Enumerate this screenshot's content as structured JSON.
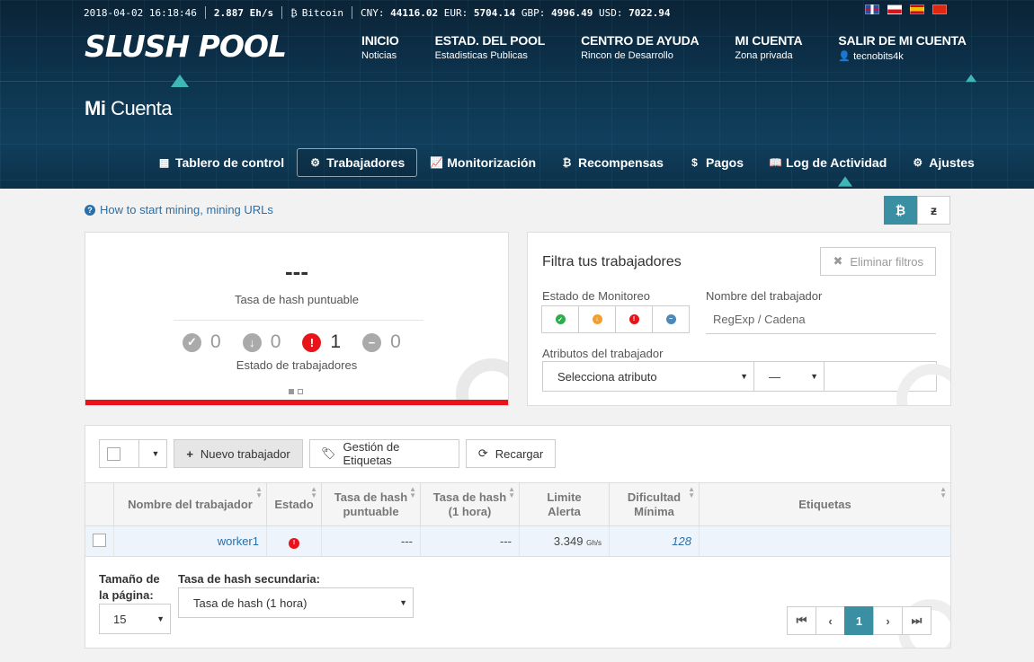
{
  "ticker": {
    "datetime": "2018-04-02 16:18:46",
    "hashrate": "2.887 Eh/s",
    "coin_symbol": "₿",
    "coin": "Bitcoin",
    "cny_label": "CNY:",
    "cny": "44116.02",
    "eur_label": "EUR:",
    "eur": "5704.14",
    "gbp_label": "GBP:",
    "gbp": "4996.49",
    "usd_label": "USD:",
    "usd": "7022.94"
  },
  "flags": [
    {
      "name": "uk-flag",
      "color": "#2b4c9a"
    },
    {
      "name": "czech-flag",
      "color": "#d7141a"
    },
    {
      "name": "spain-flag",
      "color": "#f1bf00"
    },
    {
      "name": "china-flag",
      "color": "#de2910"
    }
  ],
  "logo": "SLUSH POOL",
  "nav": [
    {
      "title": "INICIO",
      "sub": "Noticias"
    },
    {
      "title": "ESTAD. DEL POOL",
      "sub": "Estadisticas Publicas"
    },
    {
      "title": "CENTRO DE AYUDA",
      "sub": "Rincon de Desarrollo"
    },
    {
      "title": "MI CUENTA",
      "sub": "Zona privada"
    },
    {
      "title": "SALIR DE MI CUENTA",
      "sub": "tecnobits4k"
    }
  ],
  "page_title": {
    "bold": "Mi",
    "rest": " Cuenta"
  },
  "tabs": [
    {
      "label": "Tablero de control",
      "icon": "dashboard-icon"
    },
    {
      "label": "Trabajadores",
      "icon": "cogs-icon"
    },
    {
      "label": "Monitorización",
      "icon": "chart-icon"
    },
    {
      "label": "Recompensas",
      "icon": "bitcoin-icon"
    },
    {
      "label": "Pagos",
      "icon": "dollar-icon"
    },
    {
      "label": "Log de Actividad",
      "icon": "book-icon"
    },
    {
      "label": "Ajustes",
      "icon": "gear-icon"
    }
  ],
  "active_tab": "Trabajadores",
  "help_link": "How to start mining, mining URLs",
  "currency": {
    "btc": "₿",
    "zec": "ƶ"
  },
  "stats": {
    "hash_value": "---",
    "hash_label": "Tasa de hash puntuable",
    "counts": [
      {
        "name": "ok",
        "value": "0",
        "color": "#aaa"
      },
      {
        "name": "low",
        "value": "0",
        "color": "#aaa"
      },
      {
        "name": "error",
        "value": "1",
        "color": "#e8141a"
      },
      {
        "name": "off",
        "value": "0",
        "color": "#aaa"
      }
    ],
    "status_label": "Estado de trabajadores"
  },
  "filter": {
    "title": "Filtra tus trabajadores",
    "clear_label": "Eliminar filtros",
    "monitor_label": "Estado de Monitoreo",
    "name_label": "Nombre del trabajador",
    "name_placeholder": "RegExp / Cadena",
    "attr_label": "Atributos del trabajador",
    "attr_select": "Selecciona atributo",
    "op_select": "—"
  },
  "toolbar": {
    "new_worker": "Nuevo trabajador",
    "tags": "Gestión de Etiquetas",
    "reload": "Recargar"
  },
  "table": {
    "headers": [
      "Nombre del trabajador",
      "Estado",
      "Tasa de hash\npuntuable",
      "Tasa de hash\n(1 hora)",
      "Limite\nAlerta",
      "Dificultad\nMínima",
      "Etiquetas"
    ],
    "rows": [
      {
        "name": "worker1",
        "hash_score": "---",
        "hash_1h": "---",
        "alert": "3.349",
        "alert_unit": "Gh/s",
        "difficulty": "128",
        "tags": ""
      }
    ]
  },
  "footer": {
    "page_size_label": "Tamaño de la página:",
    "page_size": "15",
    "secondary_label": "Tasa de hash secundaria:",
    "secondary_value": "Tasa de hash (1 hora)",
    "current_page": "1"
  },
  "colors": {
    "accent": "#3b8fa3",
    "error": "#e8141a",
    "link": "#2a6fa8"
  }
}
